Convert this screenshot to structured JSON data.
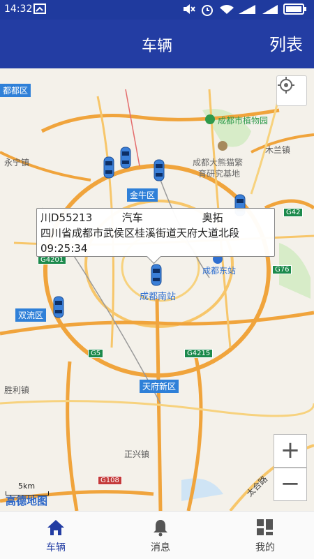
{
  "status_bar": {
    "time": "14:32"
  },
  "app_bar": {
    "title": "车辆",
    "list_label": "列表"
  },
  "map": {
    "places": {
      "botanical": "成都市植物园",
      "panda1": "成都大熊猫繁",
      "panda2": "育研究基地",
      "yongning": "永宁镇",
      "mulan": "木兰镇",
      "shengli": "胜利镇",
      "zhengxing": "正兴镇",
      "dongzhan": "成都东站",
      "taihe": "太合路"
    },
    "areas": {
      "dujiang": "都都区",
      "jinniu": "金牛区",
      "shuangliu": "双流区",
      "nanzhan": "成都南站",
      "tianfu": "天府新区"
    },
    "roads": {
      "g42": "G42",
      "g76": "G76",
      "g5": "G5",
      "g4215": "G4215",
      "g108": "G108",
      "g4201": "G4201"
    },
    "popup": {
      "plate": "川D55213",
      "type": "汽车",
      "model": "奥拓",
      "address": "四川省成都市武侯区桂溪街道天府大道北段",
      "time": "09:25:34"
    },
    "scale_label": "5km",
    "logo_text": "高德地图",
    "zoom_in": "+",
    "zoom_out": "−"
  },
  "tabs": [
    {
      "label": "车辆",
      "icon": "home-icon",
      "active": true
    },
    {
      "label": "消息",
      "icon": "bell-icon",
      "active": false
    },
    {
      "label": "我的",
      "icon": "grid-icon",
      "active": false
    }
  ],
  "colors": {
    "primary": "#233da3",
    "highway": "#f0a43c",
    "area_tag": "#2f80d8",
    "road_shield": "#1c8a4c"
  }
}
